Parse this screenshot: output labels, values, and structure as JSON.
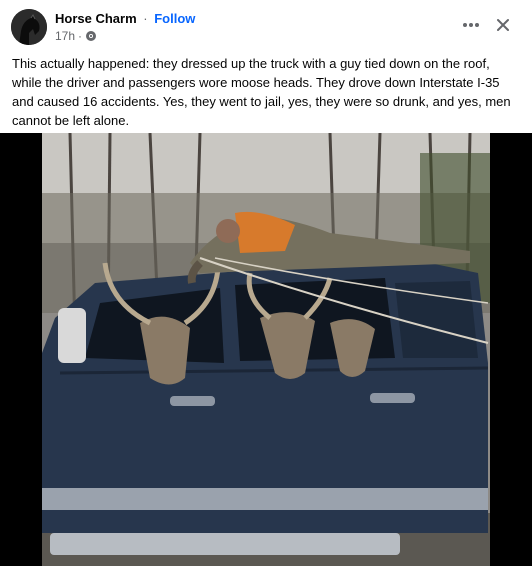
{
  "post": {
    "page_name": "Horse Charm",
    "separator": "·",
    "follow_label": "Follow",
    "timestamp": "17h",
    "meta_separator": "·",
    "audience_icon": "public-globe-icon",
    "more_icon": "more-options-icon",
    "close_icon": "close-icon",
    "caption": "This actually happened: they dressed up the truck with a guy tied down on the roof, while the driver and passengers wore moose heads. They drove down Interstate I-35 and caused 16 accidents. Yes, they went to jail, yes, they were so drunk, and yes, men cannot be left alone."
  },
  "colors": {
    "accent": "#0866ff",
    "text": "#050505",
    "secondary_text": "#65676b",
    "media_background": "#000000",
    "truck": "#27364d"
  }
}
